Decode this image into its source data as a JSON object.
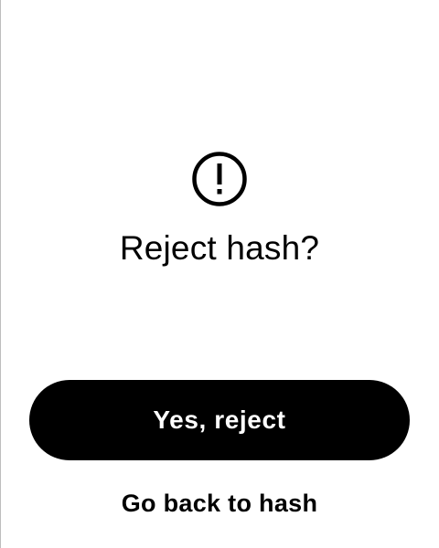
{
  "dialog": {
    "icon": "exclamation-circle-icon",
    "title": "Reject hash?"
  },
  "actions": {
    "confirm_label": "Yes, reject",
    "back_label": "Go back to hash"
  },
  "colors": {
    "background": "#ffffff",
    "primary_button": "#000000",
    "primary_button_text": "#ffffff",
    "border": "#bdbdbd"
  }
}
